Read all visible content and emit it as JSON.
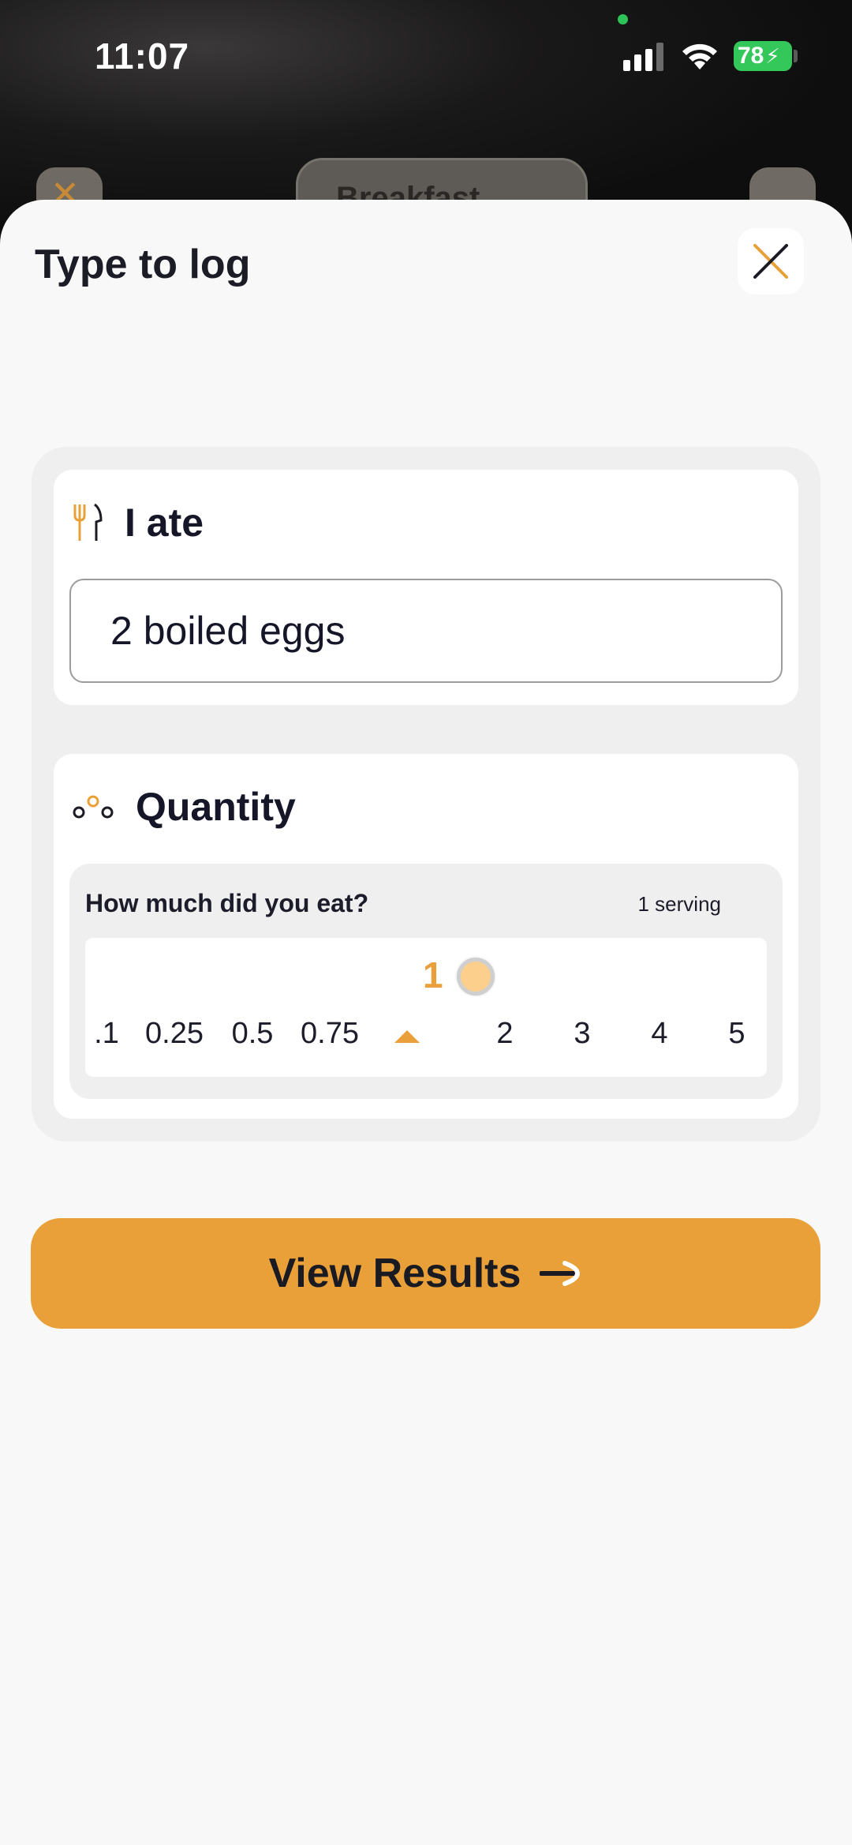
{
  "status_bar": {
    "time": "11:07",
    "battery_level": "78",
    "icons": [
      "signal-icon",
      "wifi-icon",
      "battery-icon"
    ]
  },
  "background_header": {
    "meal_label": "Breakfast"
  },
  "sheet": {
    "title": "Type to log",
    "close_icon": "close-icon"
  },
  "ate_section": {
    "icon": "fork-knife-icon",
    "label": "I ate",
    "input_value": "2 boiled eggs"
  },
  "quantity_section": {
    "icon": "quantity-dots-icon",
    "label": "Quantity",
    "question": "How much did you eat?",
    "unit": "1 serving",
    "selected_value": "1",
    "options": [
      ".1",
      "0.25",
      "0.5",
      "0.75",
      "1",
      "2",
      "3",
      "4",
      "5"
    ]
  },
  "cta": {
    "label": "View Results",
    "icon": "arrow-right-icon"
  },
  "colors": {
    "accent": "#E9A038",
    "sheet_bg": "#F8F8F8",
    "text_dark": "#161629"
  }
}
